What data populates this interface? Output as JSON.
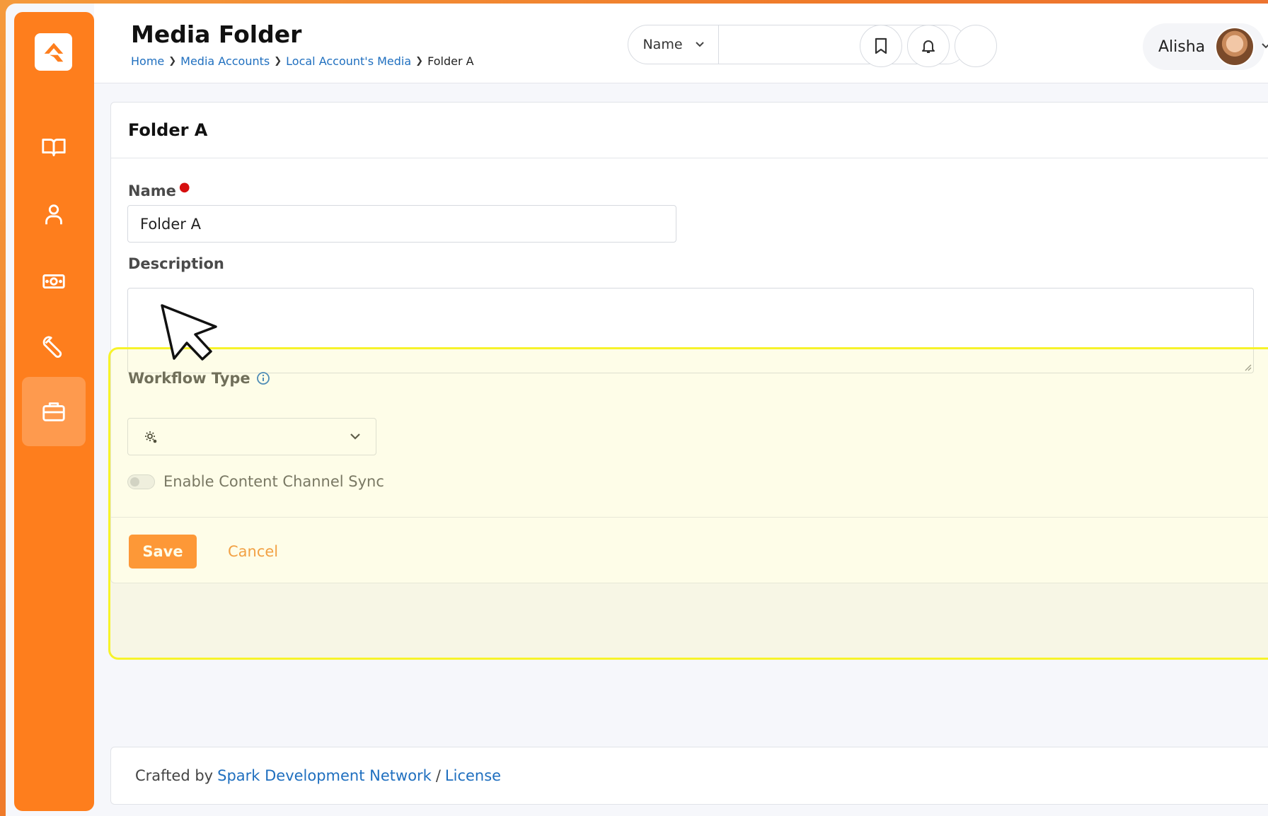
{
  "header": {
    "title": "Media Folder",
    "breadcrumb": [
      "Home",
      "Media Accounts",
      "Local Account's Media",
      "Folder A"
    ],
    "search_select": "Name",
    "search_placeholder": "",
    "user_name": "Alisha"
  },
  "sidebar": {
    "items": [
      {
        "icon": "book-icon"
      },
      {
        "icon": "person-icon"
      },
      {
        "icon": "money-icon"
      },
      {
        "icon": "wrench-icon"
      },
      {
        "icon": "briefcase-icon",
        "active": true
      }
    ]
  },
  "card": {
    "title": "Folder A",
    "name_label": "Name",
    "name_value": "Folder A",
    "description_label": "Description",
    "description_value": "",
    "workflow_label": "Workflow Type",
    "toggle_label": "Enable Content Channel Sync",
    "save_label": "Save",
    "cancel_label": "Cancel"
  },
  "footer": {
    "prefix": "Crafted by",
    "link1": "Spark Development Network",
    "separator": "/",
    "link2": "License"
  },
  "colors": {
    "accent": "#fe7e1d",
    "link": "#1f6fbf",
    "required": "#d60f0f",
    "highlight": "#f7f32a"
  }
}
